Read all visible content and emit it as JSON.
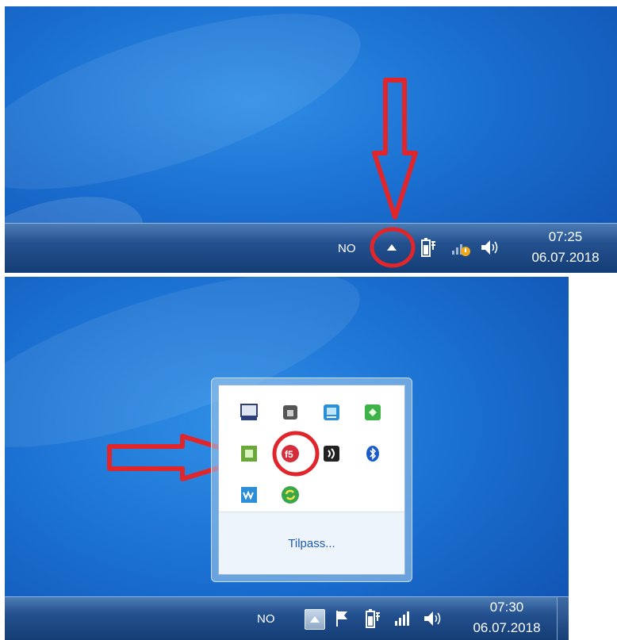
{
  "top_taskbar": {
    "language": "NO",
    "clock_time": "07:25",
    "clock_date": "06.07.2018"
  },
  "bottom_taskbar": {
    "language": "NO",
    "clock_time": "07:30",
    "clock_date": "06.07.2018"
  },
  "overflow_popup": {
    "customize_label": "Tilpass..."
  },
  "colors": {
    "annotation_red": "#e0262b",
    "desktop_blue": "#1a6fd0",
    "link_blue": "#1e5ab4"
  }
}
